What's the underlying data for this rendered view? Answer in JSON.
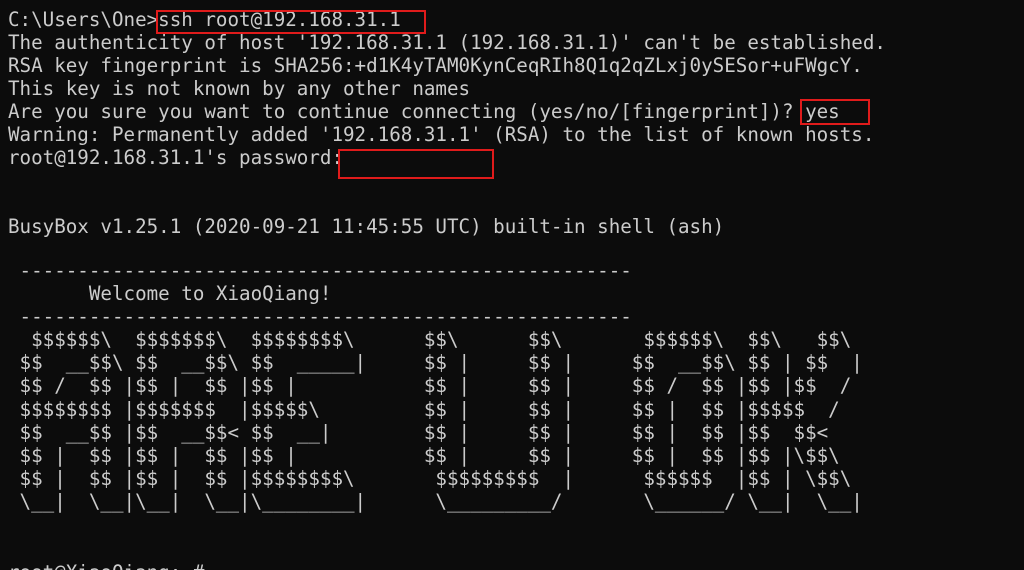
{
  "terminal": {
    "lines": [
      "C:\\Users\\One>ssh root@192.168.31.1",
      "The authenticity of host '192.168.31.1 (192.168.31.1)' can't be established.",
      "RSA key fingerprint is SHA256:+d1K4yTAM0KynCeqRIh8Q1q2qZLxj0ySESor+uFWgcY.",
      "This key is not known by any other names",
      "Are you sure you want to continue connecting (yes/no/[fingerprint])? yes",
      "Warning: Permanently added '192.168.31.1' (RSA) to the list of known hosts.",
      "root@192.168.31.1's password:"
    ],
    "busybox_banner": "BusyBox v1.25.1 (2020-09-21 11:45:55 UTC) built-in shell (ash)",
    "welcome_art": " -----------------------------------------------------\n       Welcome to XiaoQiang!\n -----------------------------------------------------\n  $$$$$$\\  $$$$$$$\\  $$$$$$$$\\      $$\\      $$\\       $$$$$$\\  $$\\   $$\\\n $$  __$$\\ $$  __$$\\ $$  _____|     $$ |     $$ |     $$  __$$\\ $$ | $$  |\n $$ /  $$ |$$ |  $$ |$$ |           $$ |     $$ |     $$ /  $$ |$$ |$$  /\n $$$$$$$$ |$$$$$$$  |$$$$$\\         $$ |     $$ |     $$ |  $$ |$$$$$  /\n $$  __$$ |$$  __$$< $$  __|        $$ |     $$ |     $$ |  $$ |$$  $$<\n $$ |  $$ |$$ |  $$ |$$ |           $$ |     $$ |     $$ |  $$ |$$ |\\$$\\\n $$ |  $$ |$$ |  $$ |$$$$$$$$\\       $$$$$$$$$  |      $$$$$$  |$$ | \\$$\\\n \\__|  \\__|\\__|  \\__|\\________|      \\_________/       \\______/ \\__|  \\__|",
    "prompt": "root@XiaoQiang:~#"
  }
}
